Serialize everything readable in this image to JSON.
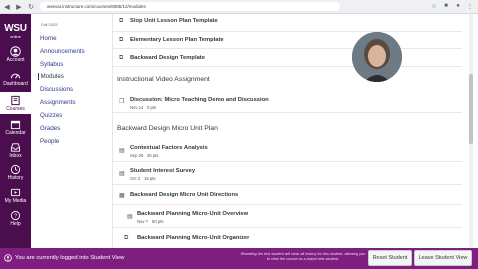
{
  "browser": {
    "url": "wsevar.instructure.com/courses/8085/12/modules"
  },
  "global_nav": {
    "logo_main": "WSU",
    "logo_sub": "online",
    "items": [
      {
        "label": "Account",
        "icon": "user-icon"
      },
      {
        "label": "Dashboard",
        "icon": "dashboard-icon"
      },
      {
        "label": "Courses",
        "icon": "book-icon"
      },
      {
        "label": "Calendar",
        "icon": "calendar-icon"
      },
      {
        "label": "Inbox",
        "icon": "inbox-icon"
      },
      {
        "label": "History",
        "icon": "clock-icon"
      },
      {
        "label": "My Media",
        "icon": "media-icon"
      },
      {
        "label": "Help",
        "icon": "help-icon"
      }
    ]
  },
  "course_nav": {
    "term": "Fall 2025",
    "items": [
      {
        "label": "Home"
      },
      {
        "label": "Announcements"
      },
      {
        "label": "Syllabus"
      },
      {
        "label": "Modules"
      },
      {
        "label": "Discussions"
      },
      {
        "label": "Assignments"
      },
      {
        "label": "Quizzes"
      },
      {
        "label": "Grades"
      },
      {
        "label": "People"
      }
    ]
  },
  "modules": {
    "items_top": [
      {
        "title": "Slop Unit Lesson Plan Template",
        "icon": "attachment-icon"
      },
      {
        "title": "Elementary Lesson Plan Template",
        "icon": "attachment-icon"
      },
      {
        "title": "Backward Design Template",
        "icon": "attachment-icon"
      }
    ],
    "module1": {
      "title": "Instructional Video Assignment",
      "items": [
        {
          "title": "Discussion: Micro Teaching Demo and Discussion",
          "date": "Nov 14",
          "points": "0 pts",
          "icon": "discussion-icon"
        }
      ]
    },
    "module2": {
      "title": "Backward Design Micro Unit Plan",
      "items": [
        {
          "title": "Contextual Factors Analysis",
          "date": "Sep 26",
          "points": "30 pts",
          "icon": "assignment-icon"
        },
        {
          "title": "Student Interest Survey",
          "date": "Oct 3",
          "points": "15 pts",
          "icon": "assignment-icon"
        },
        {
          "title": "Backward Design Micro Unit Directions",
          "icon": "page-icon"
        },
        {
          "title": "Backward Planning Micro-Unit Overview",
          "date": "Nov 7",
          "points": "50 pts",
          "icon": "assignment-icon"
        },
        {
          "title": "Backward Planning Micro-Unit Organizer",
          "icon": "attachment-icon"
        }
      ]
    }
  },
  "student_view": {
    "message": "You are currently logged into Student View",
    "note": "Resetting the test student will clear all history for this student, allowing you to view the course as a brand new student.",
    "reset_label": "Reset Student",
    "leave_label": "Leave Student View"
  },
  "colors": {
    "global_nav": "#4a0d4e",
    "student_bar": "#7e1e80",
    "link": "#2d3b8e"
  }
}
